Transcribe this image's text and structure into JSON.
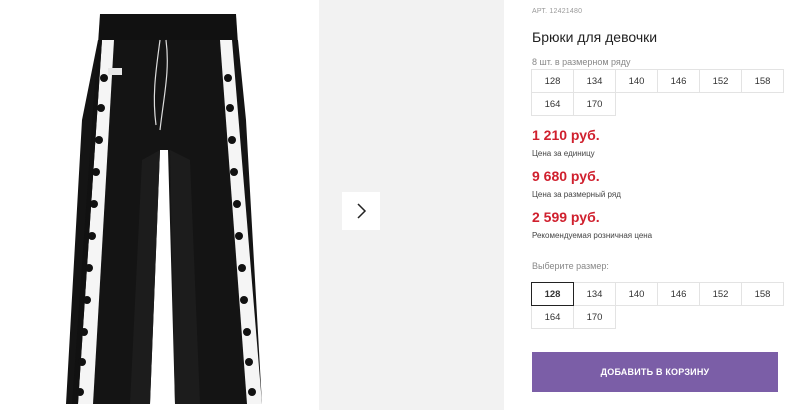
{
  "product": {
    "article": "АРТ. 12421480",
    "title": "Брюки для девочки",
    "image_icon": "pants-photo",
    "next_icon": "chevron-right-icon"
  },
  "size_row": {
    "label": "8 шт. в размерном ряду",
    "sizes": [
      "128",
      "134",
      "140",
      "146",
      "152",
      "158",
      "164",
      "170"
    ]
  },
  "prices": {
    "unit_price": "1 210 руб.",
    "unit_note": "Цена за единицу",
    "row_price": "9 680 руб.",
    "row_note": "Цена за размерный ряд",
    "retail_price": "2 599 руб.",
    "retail_note": "Рекомендуемая розничная цена"
  },
  "size_select": {
    "label": "Выберите размер:",
    "sizes": [
      "128",
      "134",
      "140",
      "146",
      "152",
      "158",
      "164",
      "170"
    ],
    "selected": "128"
  },
  "cart": {
    "button_label": "ДОБАВИТЬ В КОРЗИНУ"
  },
  "colors": {
    "price": "#d0202e",
    "button": "#7b5ea7"
  }
}
